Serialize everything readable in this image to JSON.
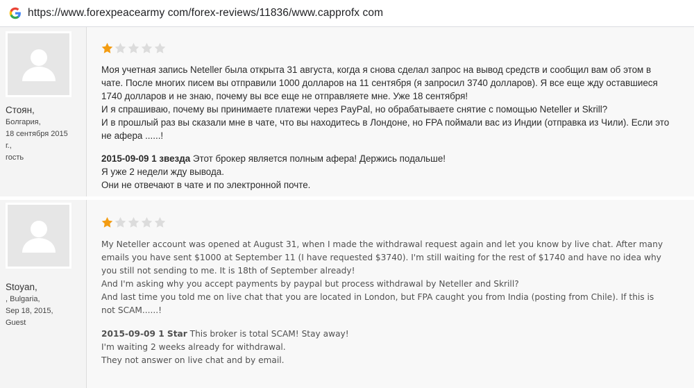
{
  "browser": {
    "url": "https://www.forexpeacearmy com/forex-reviews/11836/www.capprofx com"
  },
  "colors": {
    "star_filled": "#f39c12",
    "star_empty": "#dcdcdc"
  },
  "reviews": [
    {
      "author": {
        "name": "Стоян,",
        "location": "Болгария,",
        "date": "18 сентября 2015",
        "date_suffix": "г.,",
        "role": "гость"
      },
      "rating": 1,
      "rating_max": 5,
      "lines": [
        "Моя учетная запись Neteller была открыта 31 августа, когда я снова сделал запрос на вывод средств и сообщил вам об этом в",
        "чате. После многих писем вы отправили 1000 долларов на 11 сентября (я запросил 3740 долларов). Я все еще жду оставшиеся",
        "1740 долларов и не знаю, почему вы все еще не отправляете мне. Уже 18 сентября!",
        "И я спрашиваю, почему вы принимаете платежи через PayPal, но обрабатываете снятие с помощью Neteller и Skrill?",
        "И в прошлый раз вы сказали мне в чате, что вы находитесь в Лондоне, но FPA поймали вас из Индии (отправка из Чили). Если это",
        "не афера ......!"
      ],
      "summary": {
        "date_label": "2015-09-09 1 звезда",
        "text": "Этот брокер является полным афера! Держись подальше!",
        "lines": [
          "Я уже 2 недели жду вывода.",
          "Они не отвечают в чате и по электронной почте."
        ]
      }
    },
    {
      "author": {
        "name": "Stoyan,",
        "location": ", Bulgaria,",
        "date": "Sep 18, 2015,",
        "role": "Guest"
      },
      "rating": 1,
      "rating_max": 5,
      "lines": [
        "My Neteller account was opened at August 31, when I made the withdrawal request again and let you know by live chat. After many",
        "emails you have sent $1000 at September 11 (I have requested $3740). I'm still waiting for the rest of $1740 and have no idea why",
        "you still not sending to me. It is 18th of September already!",
        "And I'm asking why you accept payments by paypal but process withdrawal by Neteller and Skrill?",
        "And last time you told me on live chat that you are located in London, but FPA caught you from India (posting from Chile). If this is",
        "not SCAM......!"
      ],
      "summary": {
        "date_label": "2015-09-09 1 Star",
        "text": "This broker is total SCAM! Stay away!",
        "lines": [
          "I'm waiting 2 weeks already for withdrawal.",
          "They not answer on live chat and by email."
        ]
      }
    }
  ]
}
